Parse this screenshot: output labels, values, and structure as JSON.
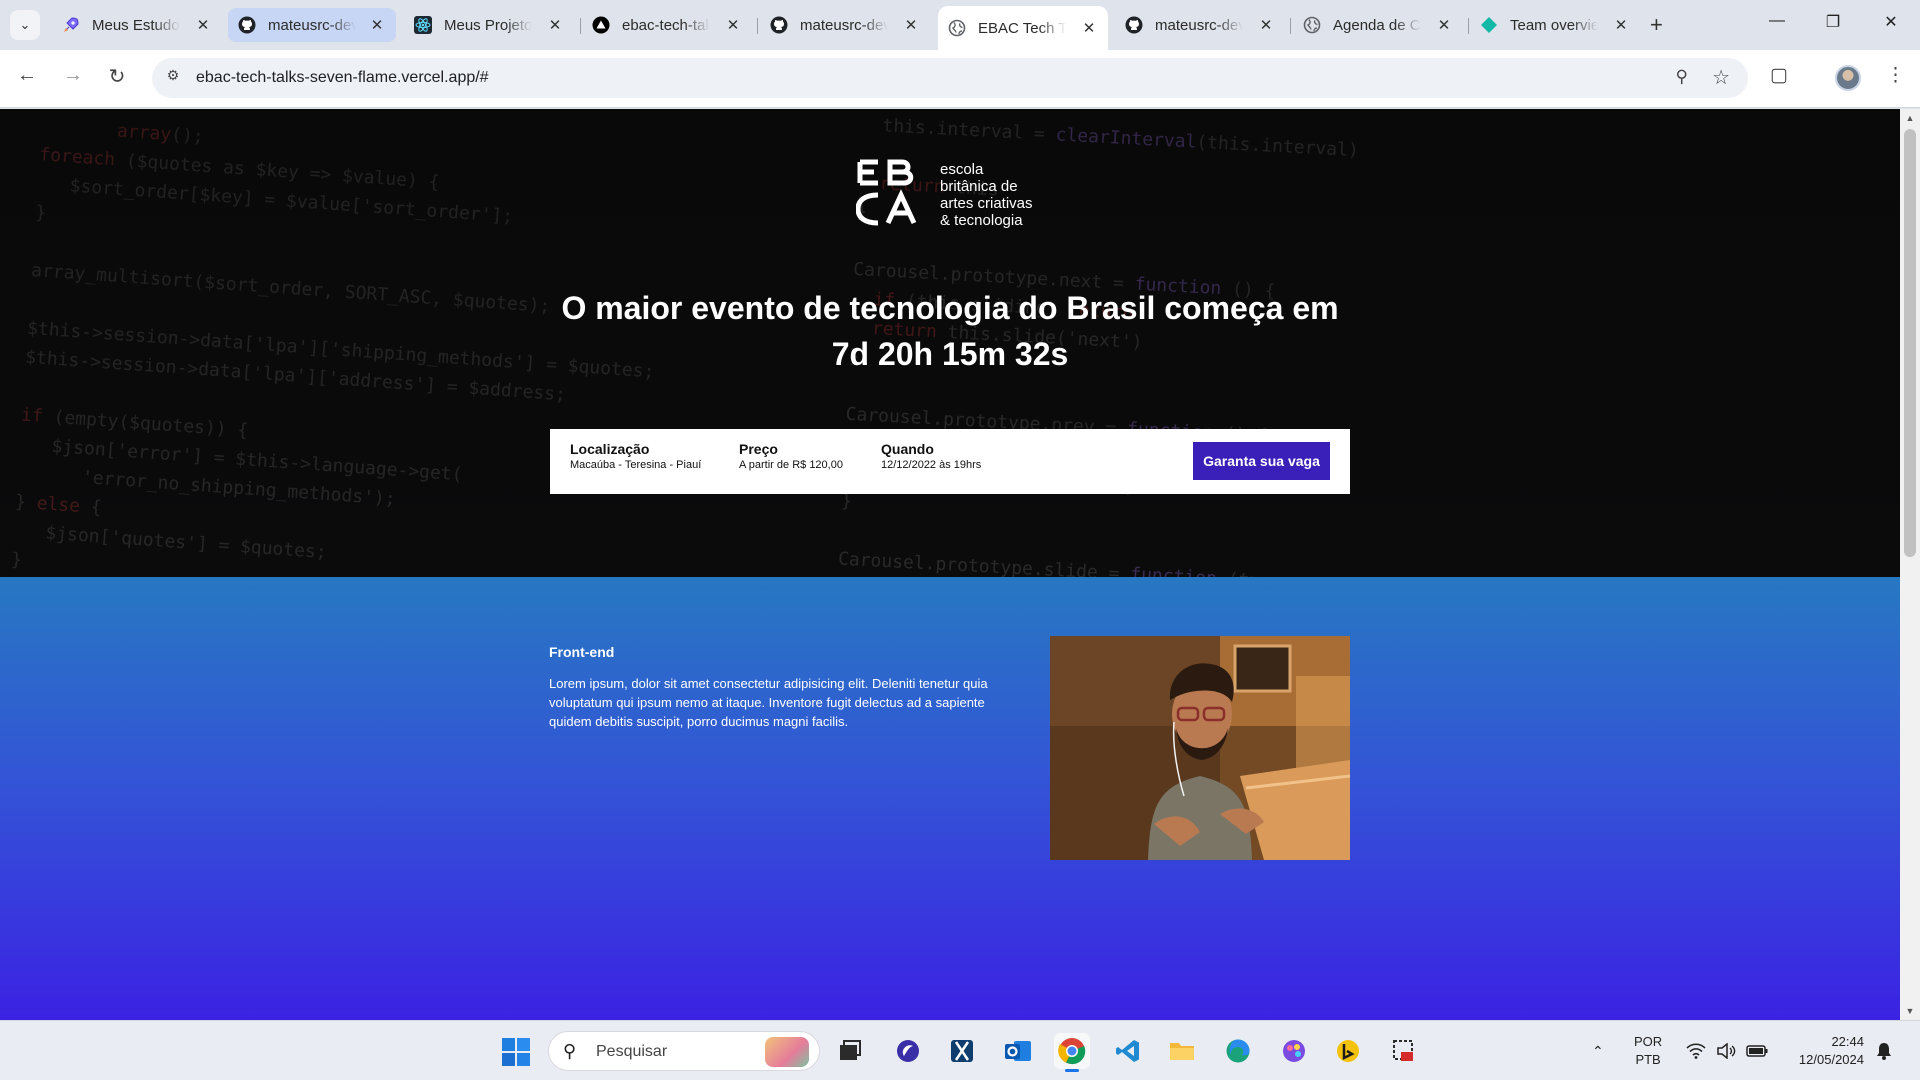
{
  "browser": {
    "tabs": [
      {
        "title": "Meus Estudos",
        "icon": "rocket-icon"
      },
      {
        "title": "mateusrc-dev",
        "icon": "github-icon"
      },
      {
        "title": "Meus Projetos",
        "icon": "react-icon"
      },
      {
        "title": "ebac-tech-talks",
        "icon": "vercel-icon"
      },
      {
        "title": "mateusrc-dev",
        "icon": "github-icon"
      },
      {
        "title": "EBAC Tech Talks",
        "icon": "globe-icon"
      },
      {
        "title": "mateusrc-dev",
        "icon": "github-icon"
      },
      {
        "title": "Agenda de Cursos",
        "icon": "globe-icon"
      },
      {
        "title": "Team overview",
        "icon": "diamond-icon"
      }
    ],
    "url": "ebac-tech-talks-seven-flame.vercel.app/#"
  },
  "page": {
    "logo_words": [
      "escola",
      "britânica de",
      "artes criativas",
      "& tecnologia"
    ],
    "hero_title": "O maior evento de tecnologia do Brasil começa em",
    "countdown": "7d 20h 15m 32s",
    "info": {
      "location_label": "Localização",
      "location_value": "Macaúba - Teresina - Piauí",
      "price_label": "Preço",
      "price_value": "A partir de R$ 120,00",
      "when_label": "Quando",
      "when_value": "12/12/2022 às 19hrs",
      "cta": "Garanta sua vaga"
    },
    "section": {
      "title": "Front-end",
      "text": "Lorem ipsum, dolor sit amet consectetur adipisicing elit. Deleniti tenetur quia voluptatum qui ipsum nemo at itaque. Inventore fugit delectus ad a sapiente quidem debitis suscipit, porro ducimus magni facilis."
    }
  },
  "taskbar": {
    "search_placeholder": "Pesquisar",
    "lang_top": "POR",
    "lang_bottom": "PTB",
    "time": "22:44",
    "date": "12/05/2024"
  },
  "colors": {
    "cta": "#3a1fb8",
    "section_top": "#2778c2",
    "section_bottom": "#3b22e3",
    "hero_bg": "#0c0c0d"
  }
}
